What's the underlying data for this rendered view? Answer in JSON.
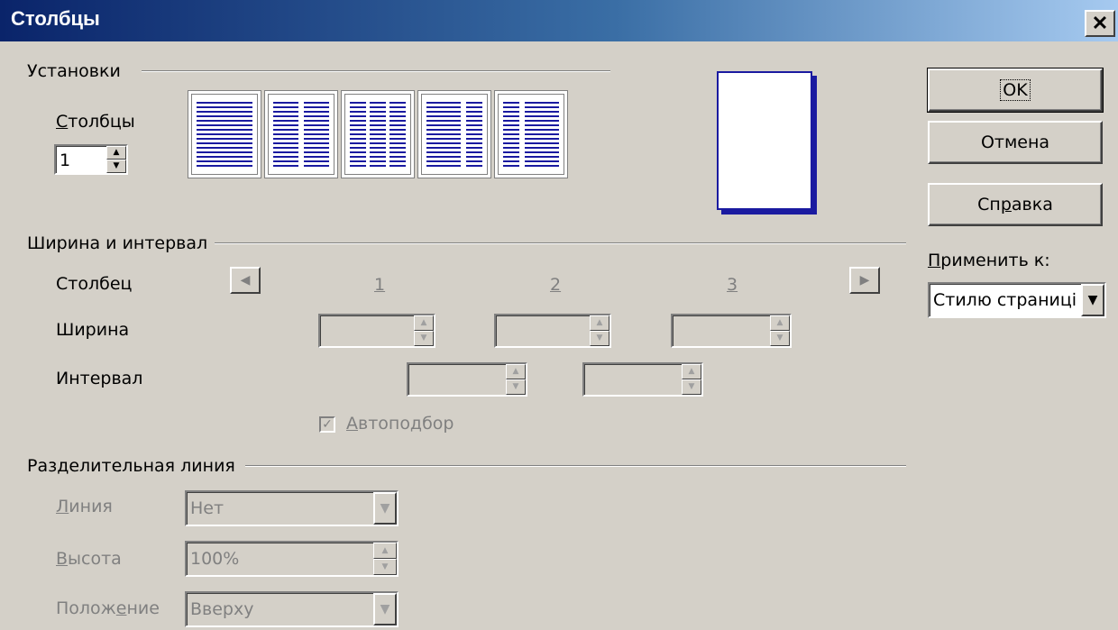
{
  "window": {
    "title": "Столбцы",
    "close_glyph": "✕"
  },
  "settings": {
    "section_label": "Установки",
    "columns_label": "Столбцы",
    "columns_mnemonic": "С",
    "columns_value": "1",
    "layouts": [
      "one-column",
      "two-columns",
      "three-columns",
      "two-columns-left-wide",
      "two-columns-right-wide"
    ]
  },
  "width_spacing": {
    "section_label": "Ширина и интервал",
    "column_label": "Столбец",
    "width_label": "Ширина",
    "spacing_label": "Интервал",
    "column_numbers": [
      "1",
      "2",
      "3"
    ],
    "autofit_label": "Автоподбор",
    "autofit_checked": true
  },
  "separator": {
    "section_label": "Разделительная линия",
    "line_label": "Линия",
    "line_value": "Нет",
    "height_label": "Высота",
    "height_value": "100%",
    "position_label": "Положение",
    "position_value": "Вверху"
  },
  "buttons": {
    "ok": "OK",
    "cancel": "Отмена",
    "help": "Справка"
  },
  "apply_to": {
    "label": "Применить к:",
    "value": "Стилю страниці"
  },
  "colors": {
    "title_start": "#0a246a",
    "title_end": "#a6caf0",
    "column_line": "#1a1aa0"
  }
}
